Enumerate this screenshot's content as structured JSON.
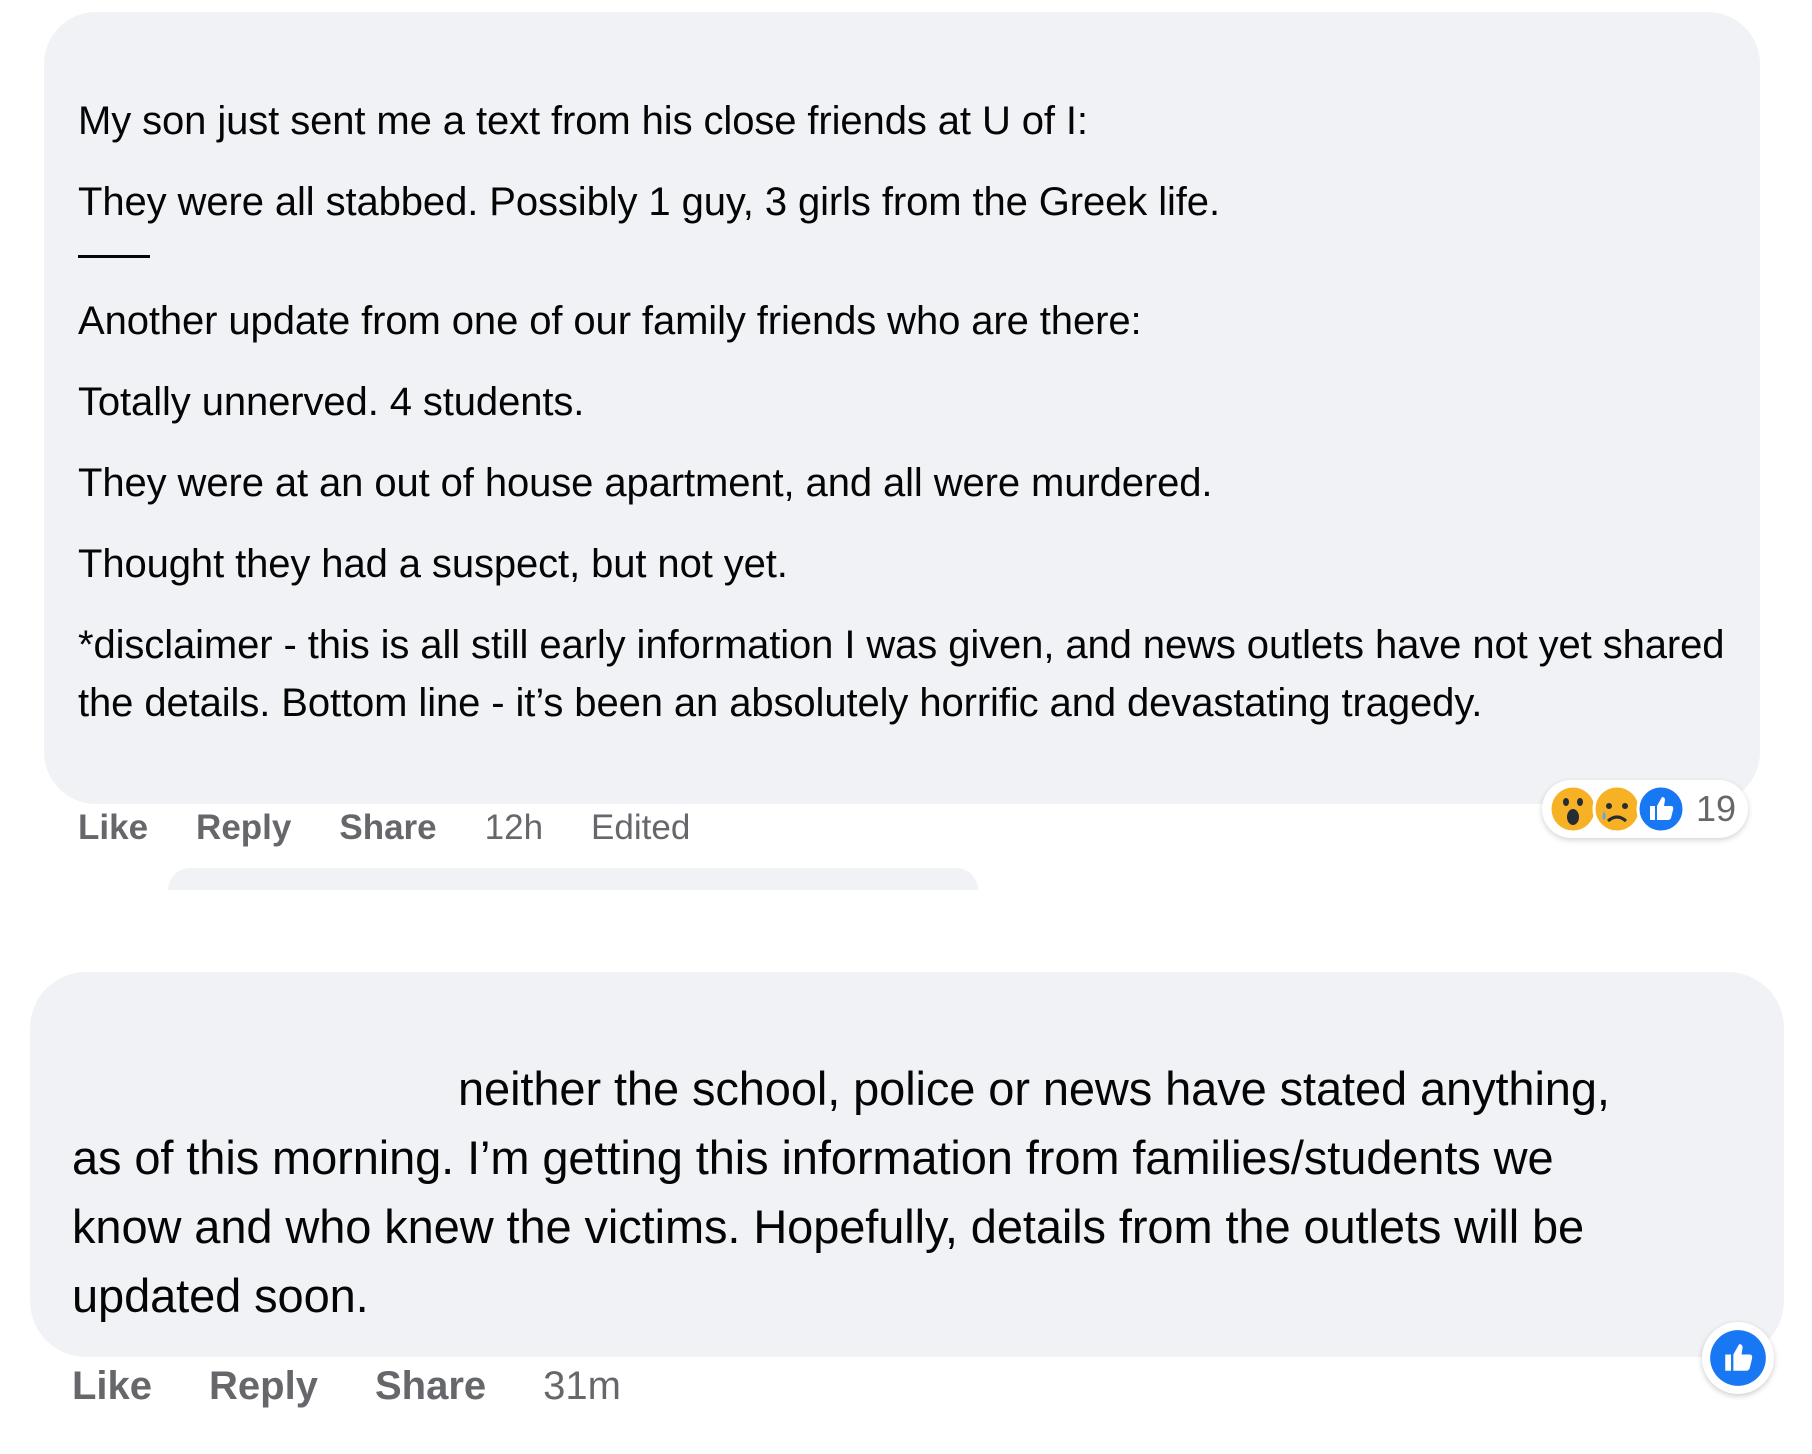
{
  "comment1": {
    "paragraphs_top": [
      "My son just sent me a text from his close friends at U of I:",
      "They were all stabbed. Possibly 1 guy, 3 girls from the Greek life."
    ],
    "paragraphs_bottom": [
      "Another update from one of our family friends who are there:",
      "Totally unnerved. 4 students.",
      "They were at an out of house apartment, and all were murdered.",
      "Thought they had a suspect, but not yet.",
      "*disclaimer - this is all still early information I was given, and news outlets have not yet shared the details. Bottom line - it’s been an absolutely horrific and devastating tragedy."
    ],
    "actions": {
      "like": "Like",
      "reply": "Reply",
      "share": "Share",
      "time": "12h",
      "edited": "Edited"
    },
    "reactions": {
      "icons": [
        "wow-reaction",
        "sad-reaction",
        "like-reaction"
      ],
      "count": "19"
    }
  },
  "comment2": {
    "text": "neither the school, police or news have stated anything, as of this morning. I’m getting this information from families/students we know and who knew the victims. Hopefully, details from the outlets will be updated soon.",
    "actions": {
      "like": "Like",
      "reply": "Reply",
      "share": "Share",
      "time": "31m"
    },
    "reaction_icon": "like-reaction"
  },
  "colors": {
    "bubble": "#f0f2f5",
    "text": "#050505",
    "muted": "#65676b",
    "like_blue": "#1877f2",
    "emoji_yellow": "#f7b125"
  }
}
